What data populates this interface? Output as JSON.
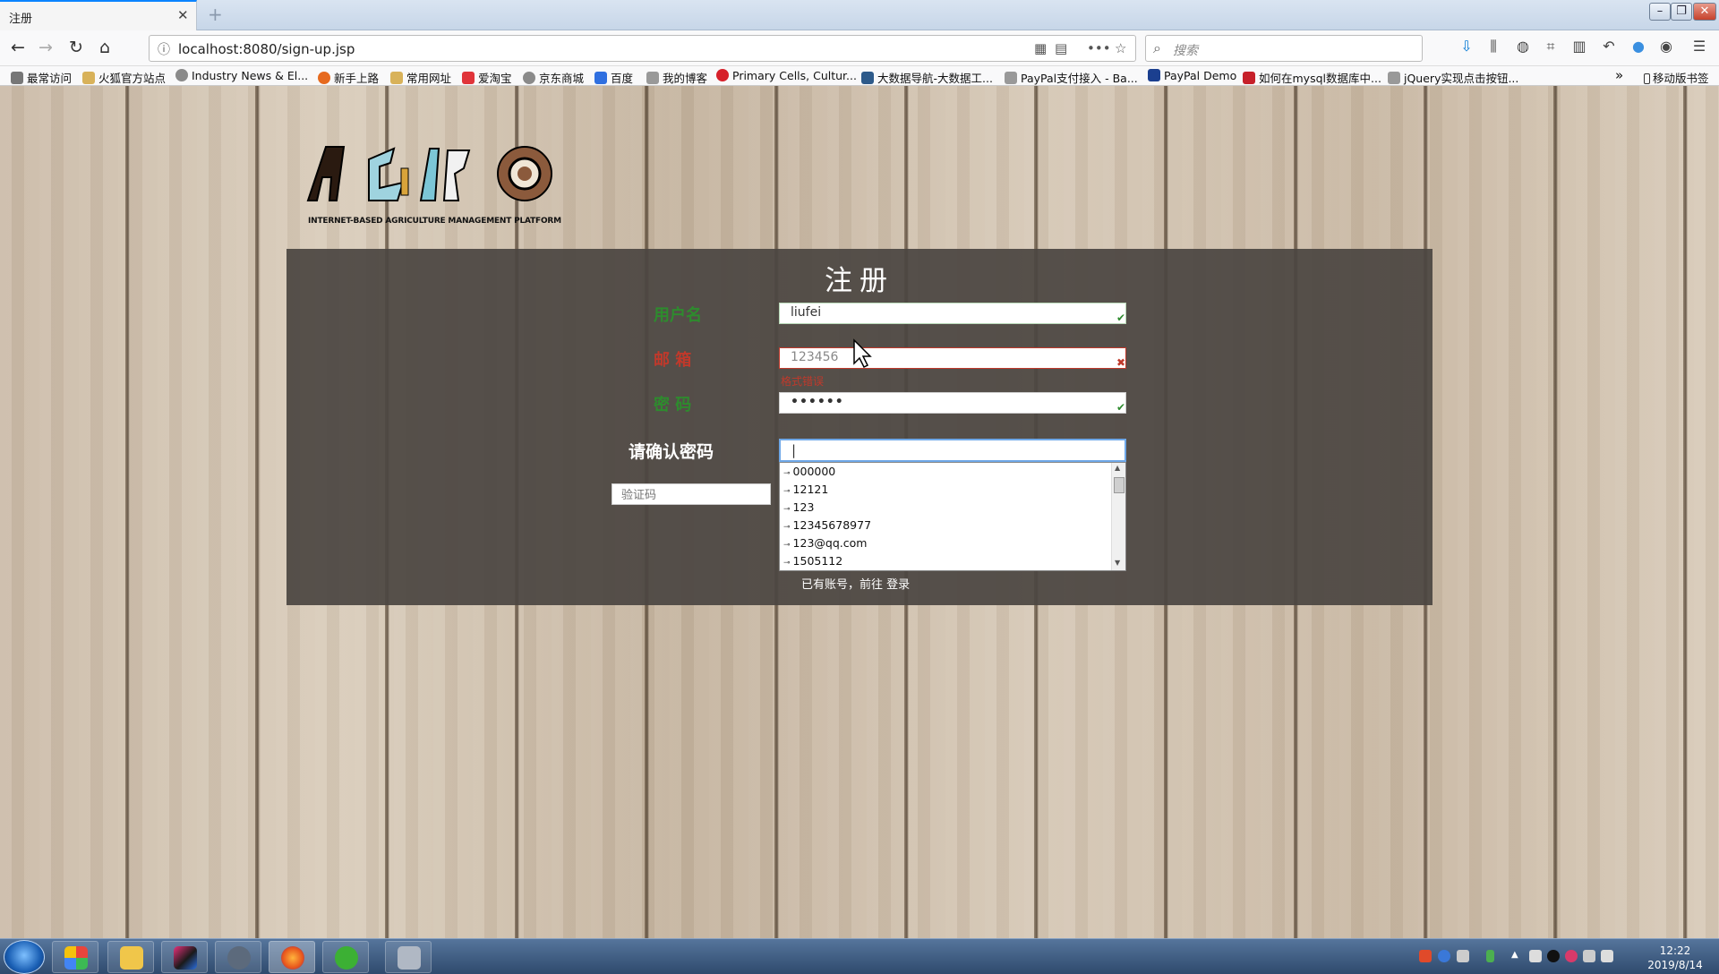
{
  "browser": {
    "tab_title": "注册",
    "tab_close": "✕",
    "new_tab": "+",
    "window_controls": {
      "min": "–",
      "max": "❐",
      "close": "✕"
    },
    "url": "localhost:8080/sign-up.jsp",
    "search_placeholder": "搜索",
    "bookmarks": [
      {
        "label": "最常访问",
        "icon": "gear-icon"
      },
      {
        "label": "火狐官方站点",
        "icon": "folder-icon"
      },
      {
        "label": "Industry News & El...",
        "icon": "globe-icon"
      },
      {
        "label": "新手上路",
        "icon": "firefox-icon"
      },
      {
        "label": "常用网址",
        "icon": "folder-icon"
      },
      {
        "label": "爱淘宝",
        "icon": "taobao-icon"
      },
      {
        "label": "京东商城",
        "icon": "globe-icon"
      },
      {
        "label": "百度",
        "icon": "baidu-icon"
      },
      {
        "label": "我的博客",
        "icon": "blog-icon"
      },
      {
        "label": "Primary Cells, Cultur...",
        "icon": "red-circle-icon"
      },
      {
        "label": "大数据导航-大数据工...",
        "icon": "chart-icon"
      },
      {
        "label": "PayPal支付接入 - Ba...",
        "icon": "blog-icon"
      },
      {
        "label": "PayPal Demo",
        "icon": "paypal-icon"
      },
      {
        "label": "如何在mysql数据库中...",
        "icon": "csdn-icon"
      },
      {
        "label": "jQuery实现点击按钮...",
        "icon": "blog-icon"
      }
    ],
    "bookmarks_overflow": "»",
    "mobile_bookmarks": "移动版书签"
  },
  "page": {
    "logo_tagline": "INTERNET-BASED AGRICULTURE MANAGEMENT PLATFORM",
    "title": "注册",
    "fields": {
      "username": {
        "label": "用户名",
        "value": "liufei",
        "status": "✔"
      },
      "email": {
        "label": "邮 箱",
        "value": "123456",
        "status": "✖",
        "error": "格式错误"
      },
      "password": {
        "label": "密 码",
        "value": "••••••",
        "status": "✔"
      },
      "confirm": {
        "label": "请确认密码",
        "value": "|"
      },
      "captcha": {
        "placeholder": "验证码"
      }
    },
    "autocomplete": [
      "000000",
      "12121",
      "123",
      "12345678977",
      "123@qq.com",
      "1505112"
    ],
    "autocomplete_key": "⊸",
    "login_prompt": "已有账号，前往 登录"
  },
  "taskbar": {
    "time": "12:22",
    "date": "2019/8/14"
  },
  "colors": {
    "ok": "#2e8b2e",
    "error": "#c0392b",
    "panel": "#4b4642"
  }
}
